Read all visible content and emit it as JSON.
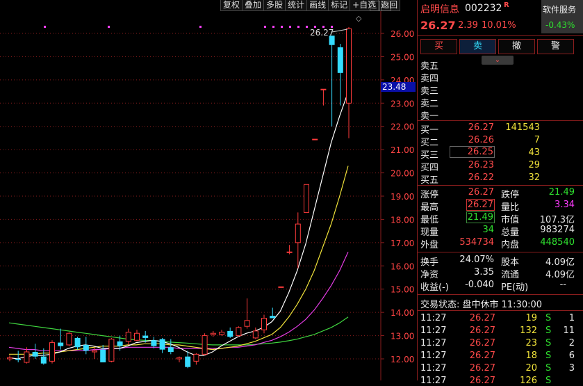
{
  "toolbar": {
    "buttons": [
      "复权",
      "叠加",
      "多股",
      "统计",
      "画线",
      "标记",
      "+自选",
      "返回"
    ],
    "window_controls": [
      "_",
      "□"
    ]
  },
  "chart_data": {
    "type": "candlestick",
    "ylim": [
      11.5,
      26.7
    ],
    "yticks": [
      "26.00",
      "25.00",
      "24.00",
      "23.00",
      "22.00",
      "21.00",
      "20.00",
      "19.00",
      "18.00",
      "17.00",
      "16.00",
      "15.00",
      "14.00",
      "13.00",
      "12.00"
    ],
    "current_price_label": "23.48",
    "high_annotation": "26.27",
    "colors": {
      "up": "#ff3b3b",
      "down": "#35dcff",
      "ma5": "#ffffff",
      "ma10": "#f0e23a",
      "ma20": "#e33ce3",
      "ma60": "#3fd43f",
      "grid": "#8a1d1d",
      "marker": "#ff40ff"
    },
    "candles": [
      {
        "o": 12.0,
        "h": 12.15,
        "l": 11.9,
        "c": 12.05
      },
      {
        "o": 12.0,
        "h": 12.35,
        "l": 11.85,
        "c": 11.95
      },
      {
        "o": 11.85,
        "h": 12.5,
        "l": 11.8,
        "c": 12.3
      },
      {
        "o": 12.3,
        "h": 12.65,
        "l": 12.0,
        "c": 12.1
      },
      {
        "o": 12.1,
        "h": 12.45,
        "l": 11.75,
        "c": 11.8
      },
      {
        "o": 11.9,
        "h": 12.8,
        "l": 11.8,
        "c": 12.7
      },
      {
        "o": 12.7,
        "h": 13.3,
        "l": 12.4,
        "c": 12.55
      },
      {
        "o": 12.6,
        "h": 13.15,
        "l": 12.55,
        "c": 13.1
      },
      {
        "o": 12.9,
        "h": 12.95,
        "l": 12.4,
        "c": 12.5
      },
      {
        "o": 12.6,
        "h": 12.95,
        "l": 12.2,
        "c": 12.35
      },
      {
        "o": 12.3,
        "h": 12.5,
        "l": 12.0,
        "c": 12.35
      },
      {
        "o": 12.4,
        "h": 12.6,
        "l": 11.85,
        "c": 11.85
      },
      {
        "o": 11.9,
        "h": 12.9,
        "l": 11.85,
        "c": 12.85
      },
      {
        "o": 12.75,
        "h": 13.0,
        "l": 12.35,
        "c": 12.55
      },
      {
        "o": 12.75,
        "h": 13.3,
        "l": 12.6,
        "c": 13.15
      },
      {
        "o": 12.8,
        "h": 13.25,
        "l": 12.75,
        "c": 13.1
      },
      {
        "o": 13.0,
        "h": 13.2,
        "l": 12.7,
        "c": 12.9
      },
      {
        "o": 12.8,
        "h": 12.95,
        "l": 12.45,
        "c": 12.55
      },
      {
        "o": 12.85,
        "h": 12.9,
        "l": 12.25,
        "c": 12.4
      },
      {
        "o": 12.5,
        "h": 12.85,
        "l": 12.2,
        "c": 12.3
      },
      {
        "o": 12.0,
        "h": 12.1,
        "l": 11.85,
        "c": 12.05
      },
      {
        "o": 12.1,
        "h": 12.35,
        "l": 11.6,
        "c": 11.65
      },
      {
        "o": 11.9,
        "h": 12.25,
        "l": 11.75,
        "c": 12.2
      },
      {
        "o": 12.2,
        "h": 13.1,
        "l": 12.15,
        "c": 13.0
      },
      {
        "o": 13.05,
        "h": 13.2,
        "l": 12.95,
        "c": 13.1
      },
      {
        "o": 13.05,
        "h": 13.25,
        "l": 13.0,
        "c": 13.15
      },
      {
        "o": 13.2,
        "h": 13.35,
        "l": 12.9,
        "c": 12.95
      },
      {
        "o": 13.0,
        "h": 13.4,
        "l": 12.95,
        "c": 13.35
      },
      {
        "o": 13.4,
        "h": 14.6,
        "l": 13.3,
        "c": 13.65
      },
      {
        "o": 12.9,
        "h": 13.35,
        "l": 12.85,
        "c": 13.2
      },
      {
        "o": 13.25,
        "h": 13.9,
        "l": 13.1,
        "c": 13.75
      },
      {
        "o": 13.85,
        "h": 14.2,
        "l": 13.75,
        "c": 13.75
      },
      {
        "o": 15.1,
        "h": 15.1,
        "l": 15.1,
        "c": 15.1
      },
      {
        "o": 16.6,
        "h": 16.9,
        "l": 16.5,
        "c": 16.6
      },
      {
        "o": 17.0,
        "h": 18.3,
        "l": 15.9,
        "c": 17.8
      },
      {
        "o": 18.3,
        "h": 19.5,
        "l": 18.3,
        "c": 19.5
      },
      {
        "o": 21.45,
        "h": 21.45,
        "l": 21.45,
        "c": 21.45
      },
      {
        "o": 23.6,
        "h": 23.6,
        "l": 22.9,
        "c": 23.6
      },
      {
        "o": 25.9,
        "h": 25.9,
        "l": 22.0,
        "c": 25.5
      },
      {
        "o": 25.4,
        "h": 25.55,
        "l": 22.9,
        "c": 24.3
      },
      {
        "o": 23.0,
        "h": 26.27,
        "l": 21.49,
        "c": 26.2
      }
    ],
    "ma5": [
      12.05,
      12.0,
      12.1,
      12.15,
      12.15,
      12.2,
      12.3,
      12.45,
      12.55,
      12.6,
      12.55,
      12.45,
      12.45,
      12.45,
      12.55,
      12.7,
      12.75,
      12.8,
      12.75,
      12.65,
      12.5,
      12.3,
      12.15,
      12.15,
      12.3,
      12.55,
      12.75,
      12.95,
      13.1,
      13.2,
      13.35,
      13.6,
      14.05,
      14.85,
      15.8,
      16.95,
      18.4,
      19.85,
      21.3,
      22.45,
      23.48
    ],
    "ma10": [
      12.2,
      12.2,
      12.2,
      12.2,
      12.25,
      12.25,
      12.3,
      12.35,
      12.4,
      12.45,
      12.5,
      12.55,
      12.55,
      12.55,
      12.6,
      12.6,
      12.65,
      12.65,
      12.65,
      12.6,
      12.6,
      12.55,
      12.5,
      12.45,
      12.4,
      12.45,
      12.5,
      12.55,
      12.65,
      12.75,
      12.9,
      13.05,
      13.35,
      13.8,
      14.35,
      15.0,
      15.8,
      16.8,
      17.8,
      19.0,
      20.3
    ],
    "ma20": [
      12.5,
      12.45,
      12.4,
      12.4,
      12.35,
      12.35,
      12.35,
      12.35,
      12.35,
      12.35,
      12.4,
      12.4,
      12.45,
      12.45,
      12.5,
      12.5,
      12.5,
      12.5,
      12.5,
      12.5,
      12.45,
      12.45,
      12.45,
      12.45,
      12.45,
      12.45,
      12.5,
      12.5,
      12.55,
      12.6,
      12.7,
      12.8,
      12.95,
      13.15,
      13.4,
      13.7,
      14.1,
      14.6,
      15.15,
      15.8,
      16.6
    ],
    "ma60": [
      13.55,
      13.5,
      13.45,
      13.4,
      13.35,
      13.3,
      13.25,
      13.2,
      13.15,
      13.1,
      13.05,
      13.0,
      12.95,
      12.9,
      12.85,
      12.82,
      12.8,
      12.78,
      12.75,
      12.72,
      12.7,
      12.68,
      12.65,
      12.62,
      12.6,
      12.6,
      12.6,
      12.6,
      12.6,
      12.62,
      12.65,
      12.68,
      12.72,
      12.78,
      12.85,
      12.95,
      13.05,
      13.2,
      13.35,
      13.55,
      13.8
    ]
  },
  "quote": {
    "name": "启明信息",
    "code": "002232",
    "r_mark": "R",
    "service_label": "软件服务",
    "sector_change": "-0.43%",
    "price": "26.27",
    "change": "2.39",
    "change_pct": "10.01%",
    "trade_buttons": [
      "买",
      "卖",
      "撤",
      "警"
    ],
    "sell_levels": [
      {
        "label": "卖五",
        "price": "",
        "vol": ""
      },
      {
        "label": "卖四",
        "price": "",
        "vol": ""
      },
      {
        "label": "卖三",
        "price": "",
        "vol": ""
      },
      {
        "label": "卖二",
        "price": "",
        "vol": ""
      },
      {
        "label": "卖一",
        "price": "",
        "vol": ""
      }
    ],
    "buy_levels": [
      {
        "label": "买一",
        "price": "26.27",
        "vol": "141543"
      },
      {
        "label": "买二",
        "price": "26.26",
        "vol": "7"
      },
      {
        "label": "买三",
        "price": "26.25",
        "vol": "43"
      },
      {
        "label": "买四",
        "price": "26.23",
        "vol": "29"
      },
      {
        "label": "买五",
        "price": "26.22",
        "vol": "32"
      }
    ],
    "stats": {
      "limit_up_label": "涨停",
      "limit_up": "26.27",
      "limit_down_label": "跌停",
      "limit_down": "21.49",
      "high_label": "最高",
      "high": "26.27",
      "vol_ratio_label": "量比",
      "vol_ratio": "3.34",
      "low_label": "最低",
      "low": "21.49",
      "mcap_label": "市值",
      "mcap": "107.3亿",
      "cur_vol_label": "现量",
      "cur_vol": "34",
      "total_vol_label": "总量",
      "total_vol": "983274",
      "outer_label": "外盘",
      "outer": "534734",
      "inner_label": "内盘",
      "inner": "448540",
      "turnover_label": "换手",
      "turnover": "24.07%",
      "shares_label": "股本",
      "shares": "4.09亿",
      "nav_label": "净资",
      "nav": "3.35",
      "float_label": "流通",
      "float": "4.09亿",
      "eps_label": "收益(-)",
      "eps": "-0.040",
      "pe_label": "PE(动)",
      "pe": "--"
    },
    "trade_status": "交易状态: 盘中休市 11:30:00",
    "ticks": [
      {
        "time": "11:27",
        "price": "26.27",
        "vol": "19",
        "side": "S",
        "count": "1"
      },
      {
        "time": "11:27",
        "price": "26.27",
        "vol": "132",
        "side": "S",
        "count": "11"
      },
      {
        "time": "11:27",
        "price": "26.27",
        "vol": "23",
        "side": "S",
        "count": "2"
      },
      {
        "time": "11:27",
        "price": "26.27",
        "vol": "18",
        "side": "S",
        "count": "6"
      },
      {
        "time": "11:27",
        "price": "26.27",
        "vol": "20",
        "side": "S",
        "count": "3"
      },
      {
        "time": "11:27",
        "price": "26.27",
        "vol": "126",
        "side": "S",
        "count": ""
      }
    ]
  }
}
